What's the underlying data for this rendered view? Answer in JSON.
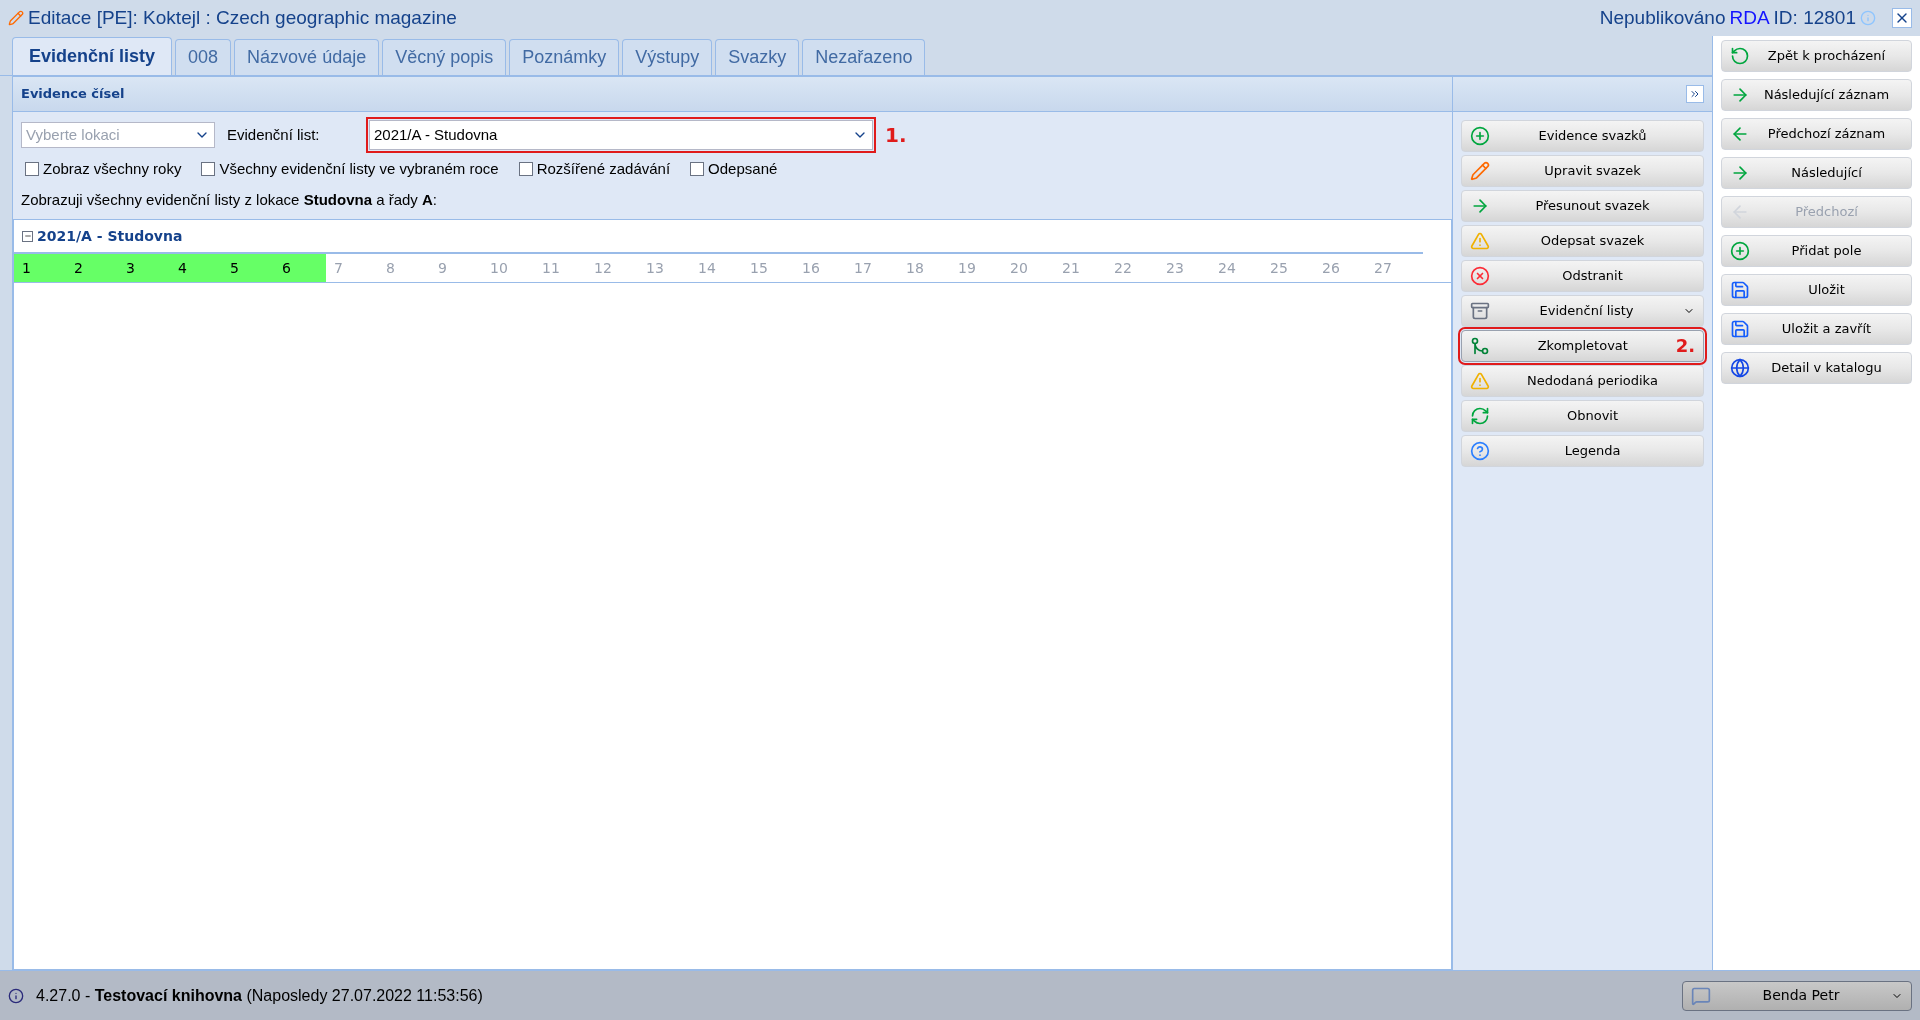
{
  "window": {
    "title": "Editace [PE]: Koktejl : Czech geographic magazine",
    "status_prefix": "Nepublikováno",
    "status_rda": "RDA",
    "status_id": "ID: 12801"
  },
  "tabs": [
    {
      "label": "Evidenční listy",
      "selected": true
    },
    {
      "label": "008",
      "selected": false
    },
    {
      "label": "Názvové údaje",
      "selected": false
    },
    {
      "label": "Věcný popis",
      "selected": false
    },
    {
      "label": "Poznámky",
      "selected": false
    },
    {
      "label": "Výstupy",
      "selected": false
    },
    {
      "label": "Svazky",
      "selected": false
    },
    {
      "label": "Nezařazeno",
      "selected": false
    }
  ],
  "panel": {
    "title": "Evidence čísel",
    "location": {
      "placeholder": "Vyberte lokaci"
    },
    "sheet_label": "Evidenční list:",
    "sheet": {
      "value": "2021/A - Studovna",
      "annotation": "1."
    },
    "options": [
      {
        "label": "Zobraz všechny roky",
        "checked": false
      },
      {
        "label": "Všechny evidenční listy ve vybraném roce",
        "checked": false
      },
      {
        "label": "Rozšířené zadávání",
        "checked": false
      },
      {
        "label": "Odepsané",
        "checked": false
      }
    ],
    "info": "Zobrazuji všechny evidenční listy z lokace **Studovna** a řady **A**:",
    "tree": {
      "label": "2021/A - Studovna",
      "expanded": true,
      "issues": [
        {
          "label": "1",
          "received": true
        },
        {
          "label": "2",
          "received": true
        },
        {
          "label": "3",
          "received": true
        },
        {
          "label": "4",
          "received": true
        },
        {
          "label": "5",
          "received": true
        },
        {
          "label": "6",
          "received": true
        },
        {
          "label": "7",
          "received": false
        },
        {
          "label": "8",
          "received": false
        },
        {
          "label": "9",
          "received": false
        },
        {
          "label": "10",
          "received": false
        },
        {
          "label": "11",
          "received": false
        },
        {
          "label": "12",
          "received": false
        },
        {
          "label": "13",
          "received": false
        },
        {
          "label": "14",
          "received": false
        },
        {
          "label": "15",
          "received": false
        },
        {
          "label": "16",
          "received": false
        },
        {
          "label": "17",
          "received": false
        },
        {
          "label": "18",
          "received": false
        },
        {
          "label": "19",
          "received": false
        },
        {
          "label": "20",
          "received": false
        },
        {
          "label": "21",
          "received": false
        },
        {
          "label": "22",
          "received": false
        },
        {
          "label": "23",
          "received": false
        },
        {
          "label": "24",
          "received": false
        },
        {
          "label": "25",
          "received": false
        },
        {
          "label": "26",
          "received": false
        },
        {
          "label": "27",
          "received": false
        }
      ]
    }
  },
  "actions": [
    {
      "label": "Evidence svazků"
    },
    {
      "label": "Upravit svazek"
    },
    {
      "label": "Přesunout svazek"
    },
    {
      "label": "Odepsat svazek"
    },
    {
      "label": "Odstranit"
    },
    {
      "label": "Evidenční listy",
      "has_menu": true
    },
    {
      "label": "Zkompletovat",
      "annotation": "2."
    },
    {
      "label": "Nedodaná periodika"
    },
    {
      "label": "Obnovit"
    },
    {
      "label": "Legenda"
    }
  ],
  "record_actions": [
    {
      "label": "Zpět k procházení",
      "disabled": false
    },
    {
      "label": "Následující záznam",
      "disabled": false
    },
    {
      "label": "Předchozí záznam",
      "disabled": false
    },
    {
      "label": "Následující",
      "disabled": false
    },
    {
      "label": "Předchozí",
      "disabled": true
    },
    {
      "label": "Přidat pole",
      "disabled": false
    },
    {
      "label": "Uložit",
      "disabled": false
    },
    {
      "label": "Uložit a zavřít",
      "disabled": false
    },
    {
      "label": "Detail v katalogu",
      "disabled": false
    }
  ],
  "status_bar": {
    "text": "4.27.0 - **Testovací knihovna** (Naposledy 27.07.2022 11:53:56)",
    "user": "Benda Petr"
  }
}
